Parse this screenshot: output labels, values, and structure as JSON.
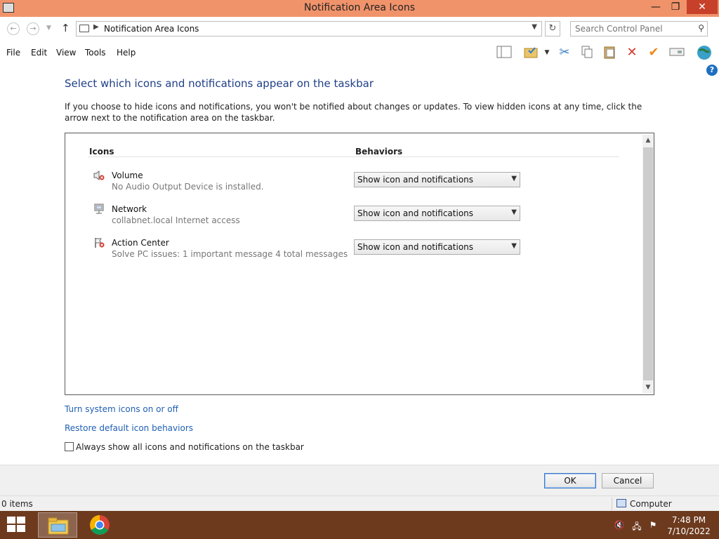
{
  "window": {
    "title": "Notification Area Icons",
    "minimize_glyph": "—",
    "maximize_glyph": "❐",
    "close_glyph": "✕"
  },
  "address": {
    "path": "Notification Area Icons",
    "search_placeholder": "Search Control Panel"
  },
  "menu": [
    "File",
    "Edit",
    "View",
    "Tools",
    "Help"
  ],
  "toolbar_icons": [
    "layout-icon",
    "folder-options-icon",
    "dropdown-icon",
    "cut-icon",
    "copy-icon",
    "paste-icon",
    "delete-icon",
    "check-icon",
    "properties-icon",
    "globe-icon",
    "help-icon"
  ],
  "main": {
    "heading": "Select which icons and notifications appear on the taskbar",
    "description": "If you choose to hide icons and notifications, you won't be notified about changes or updates. To view hidden icons at any time, click the arrow next to the notification area on the taskbar.",
    "columns": {
      "icons": "Icons",
      "behaviors": "Behaviors"
    },
    "rows": [
      {
        "icon": "volume-muted-icon",
        "name": "Volume",
        "description": "No Audio Output Device is installed.",
        "behavior": "Show icon and notifications"
      },
      {
        "icon": "network-icon",
        "name": "Network",
        "description": "collabnet.local Internet access",
        "behavior": "Show icon and notifications"
      },
      {
        "icon": "action-center-flag-icon",
        "name": "Action Center",
        "description": "Solve PC issues: 1 important message  4 total messages",
        "behavior": "Show icon and notifications"
      }
    ],
    "links": {
      "system_icons": "Turn system icons on or off",
      "restore": "Restore default icon behaviors"
    },
    "always_show": {
      "label": "Always show all icons and notifications on the taskbar",
      "checked": false
    }
  },
  "buttons": {
    "ok": "OK",
    "cancel": "Cancel"
  },
  "status": {
    "items": "0 items",
    "location": "Computer"
  },
  "taskbar": {
    "time": "7:48 PM",
    "date": "7/10/2022"
  },
  "colors": {
    "titlebar": "#f0936b",
    "taskbar": "#6d3a1e",
    "heading": "#1f3f86",
    "link": "#1f5fb4"
  }
}
